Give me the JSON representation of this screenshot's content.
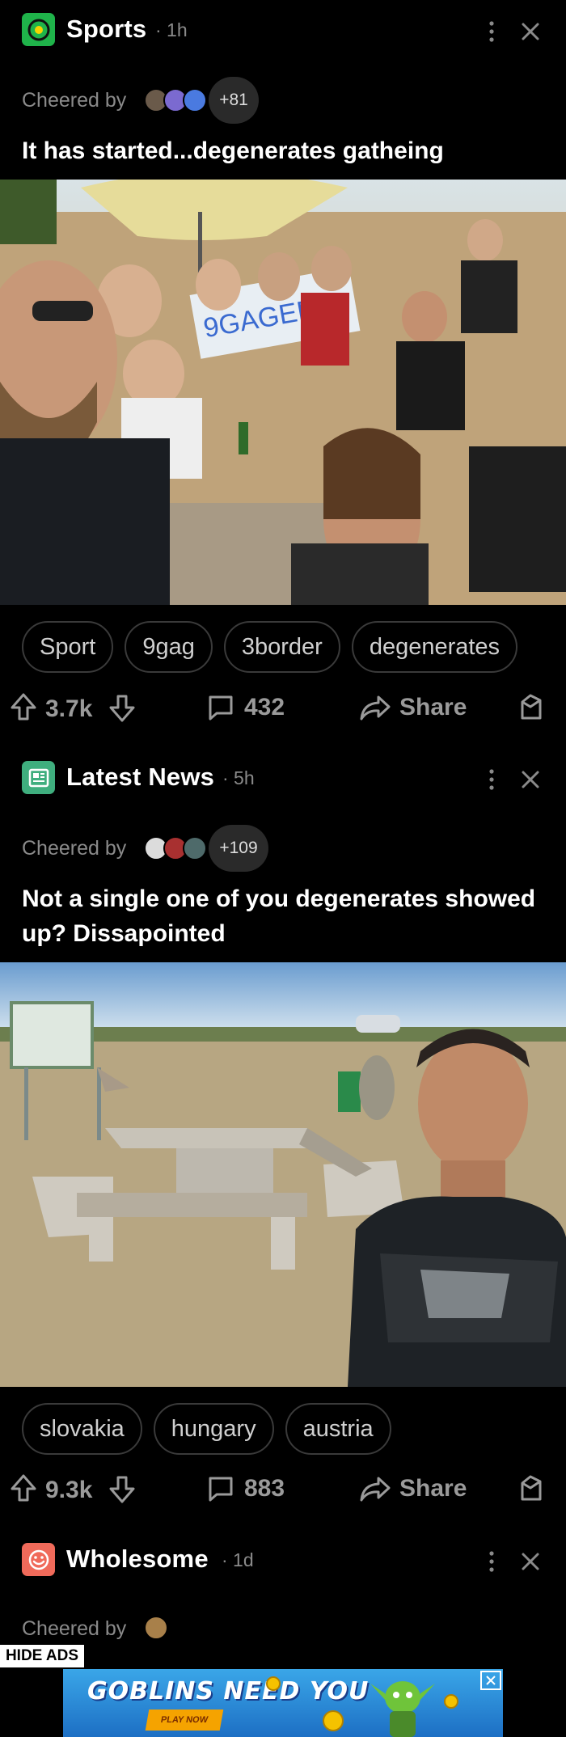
{
  "posts": [
    {
      "community": "Sports",
      "time": "· 1h",
      "cheered_label": "Cheered by",
      "cheered_more": "+81",
      "title": "It has started...degenerates gatheing",
      "photo_sign": "9GAGERS",
      "tags": [
        "Sport",
        "9gag",
        "3border",
        "degenerates"
      ],
      "votes": "3.7k",
      "comments": "432",
      "share": "Share",
      "accent": "#1fb34a"
    },
    {
      "community": "Latest News",
      "time": "· 5h",
      "cheered_label": "Cheered by",
      "cheered_more": "+109",
      "title": "Not a single one of you degenerates showed up? Dissapointed",
      "tags": [
        "slovakia",
        "hungary",
        "austria"
      ],
      "votes": "9.3k",
      "comments": "883",
      "share": "Share",
      "accent": "#3fae7e"
    },
    {
      "community": "Wholesome",
      "time": "· 1d",
      "cheered_label": "Cheered by",
      "accent": "#f06a5a"
    }
  ],
  "ad": {
    "hide_label": "HIDE ADS",
    "headline": "GOBLINS NEED YOU",
    "cta": "PLAY NOW"
  }
}
